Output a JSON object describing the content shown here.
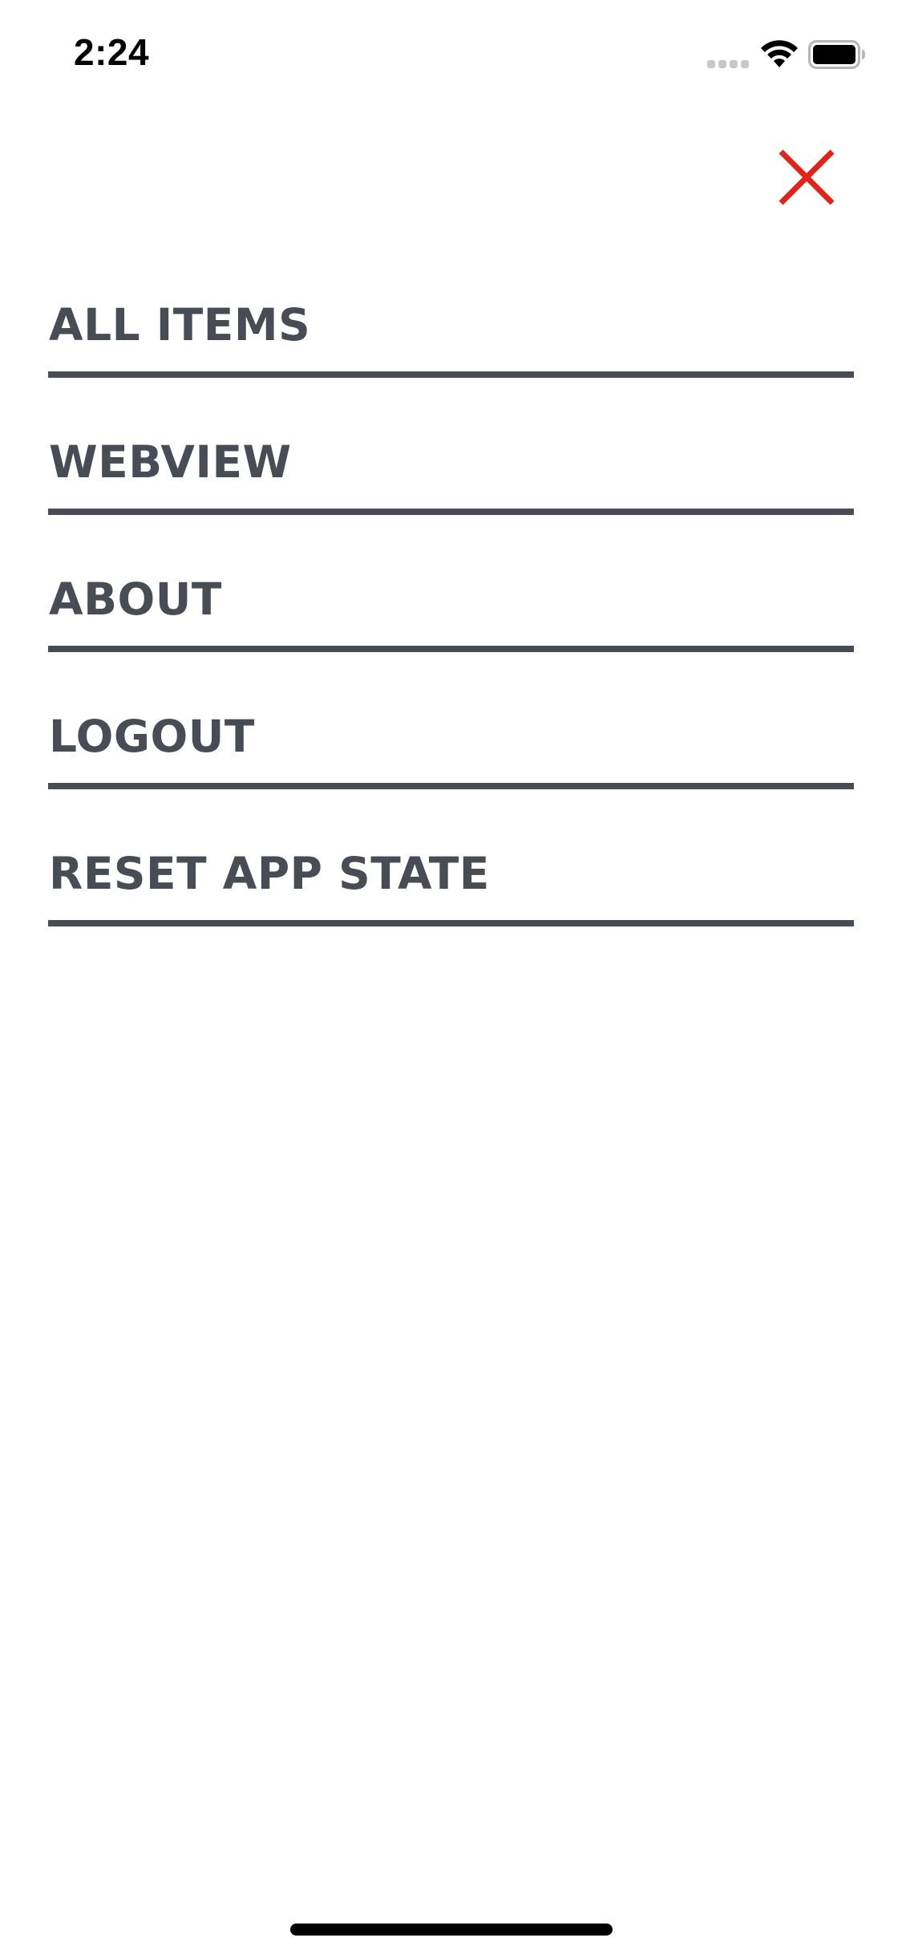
{
  "status_bar": {
    "time": "2:24",
    "signal_icon": "cellular-signal-icon",
    "wifi_icon": "wifi-icon",
    "battery_icon": "battery-icon"
  },
  "close": {
    "icon": "close-icon",
    "color": "#e2231a"
  },
  "menu": {
    "items": [
      {
        "label": "ALL ITEMS"
      },
      {
        "label": "WEBVIEW"
      },
      {
        "label": "ABOUT"
      },
      {
        "label": "LOGOUT"
      },
      {
        "label": "RESET APP STATE"
      }
    ],
    "text_color": "#484c55"
  }
}
